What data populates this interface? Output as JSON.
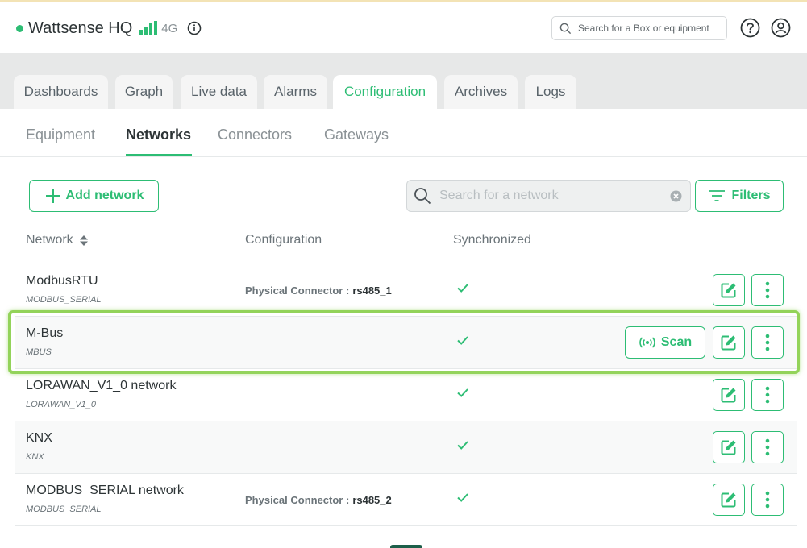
{
  "header": {
    "site_name": "Wattsense HQ",
    "network_type": "4G",
    "search_placeholder": "Search for a Box or equipment",
    "colors": {
      "accent": "#2dbd74",
      "online": "#2dbd74"
    }
  },
  "main_tabs": [
    {
      "label": "Dashboards",
      "active": false
    },
    {
      "label": "Graph",
      "active": false
    },
    {
      "label": "Live data",
      "active": false
    },
    {
      "label": "Alarms",
      "active": false
    },
    {
      "label": "Configuration",
      "active": true
    },
    {
      "label": "Archives",
      "active": false
    },
    {
      "label": "Logs",
      "active": false
    }
  ],
  "sub_tabs": [
    {
      "label": "Equipment",
      "active": false
    },
    {
      "label": "Networks",
      "active": true
    },
    {
      "label": "Connectors",
      "active": false
    },
    {
      "label": "Gateways",
      "active": false
    }
  ],
  "toolbar": {
    "add_label": "Add network",
    "search_placeholder": "Search for a network",
    "filters_label": "Filters"
  },
  "table": {
    "columns": [
      "Network",
      "Configuration",
      "Synchronized"
    ],
    "rows": [
      {
        "name": "ModbusRTU",
        "type": "MODBUS_SERIAL",
        "config_key": "Physical Connector :",
        "config_value": "rs485_1",
        "synchronized": true
      },
      {
        "name": "M-Bus",
        "type": "MBUS",
        "config_key": "",
        "config_value": "",
        "synchronized": true,
        "scan_label": "Scan",
        "highlighted": true
      },
      {
        "name": "LORAWAN_V1_0 network",
        "type": "LORAWAN_V1_0",
        "config_key": "",
        "config_value": "",
        "synchronized": true
      },
      {
        "name": "KNX",
        "type": "KNX",
        "config_key": "",
        "config_value": "",
        "synchronized": true
      },
      {
        "name": "MODBUS_SERIAL network",
        "type": "MODBUS_SERIAL",
        "config_key": "Physical Connector :",
        "config_value": "rs485_2",
        "synchronized": true
      }
    ]
  },
  "icons": {
    "signal": "signal-bars-icon",
    "info": "info-icon",
    "search": "search-icon",
    "help": "help-icon",
    "user": "user-icon",
    "plus": "plus-icon",
    "filter": "filter-icon",
    "clear": "clear-icon",
    "check": "check-icon",
    "edit": "edit-icon",
    "more": "more-vertical-icon",
    "scan": "scan-icon"
  }
}
